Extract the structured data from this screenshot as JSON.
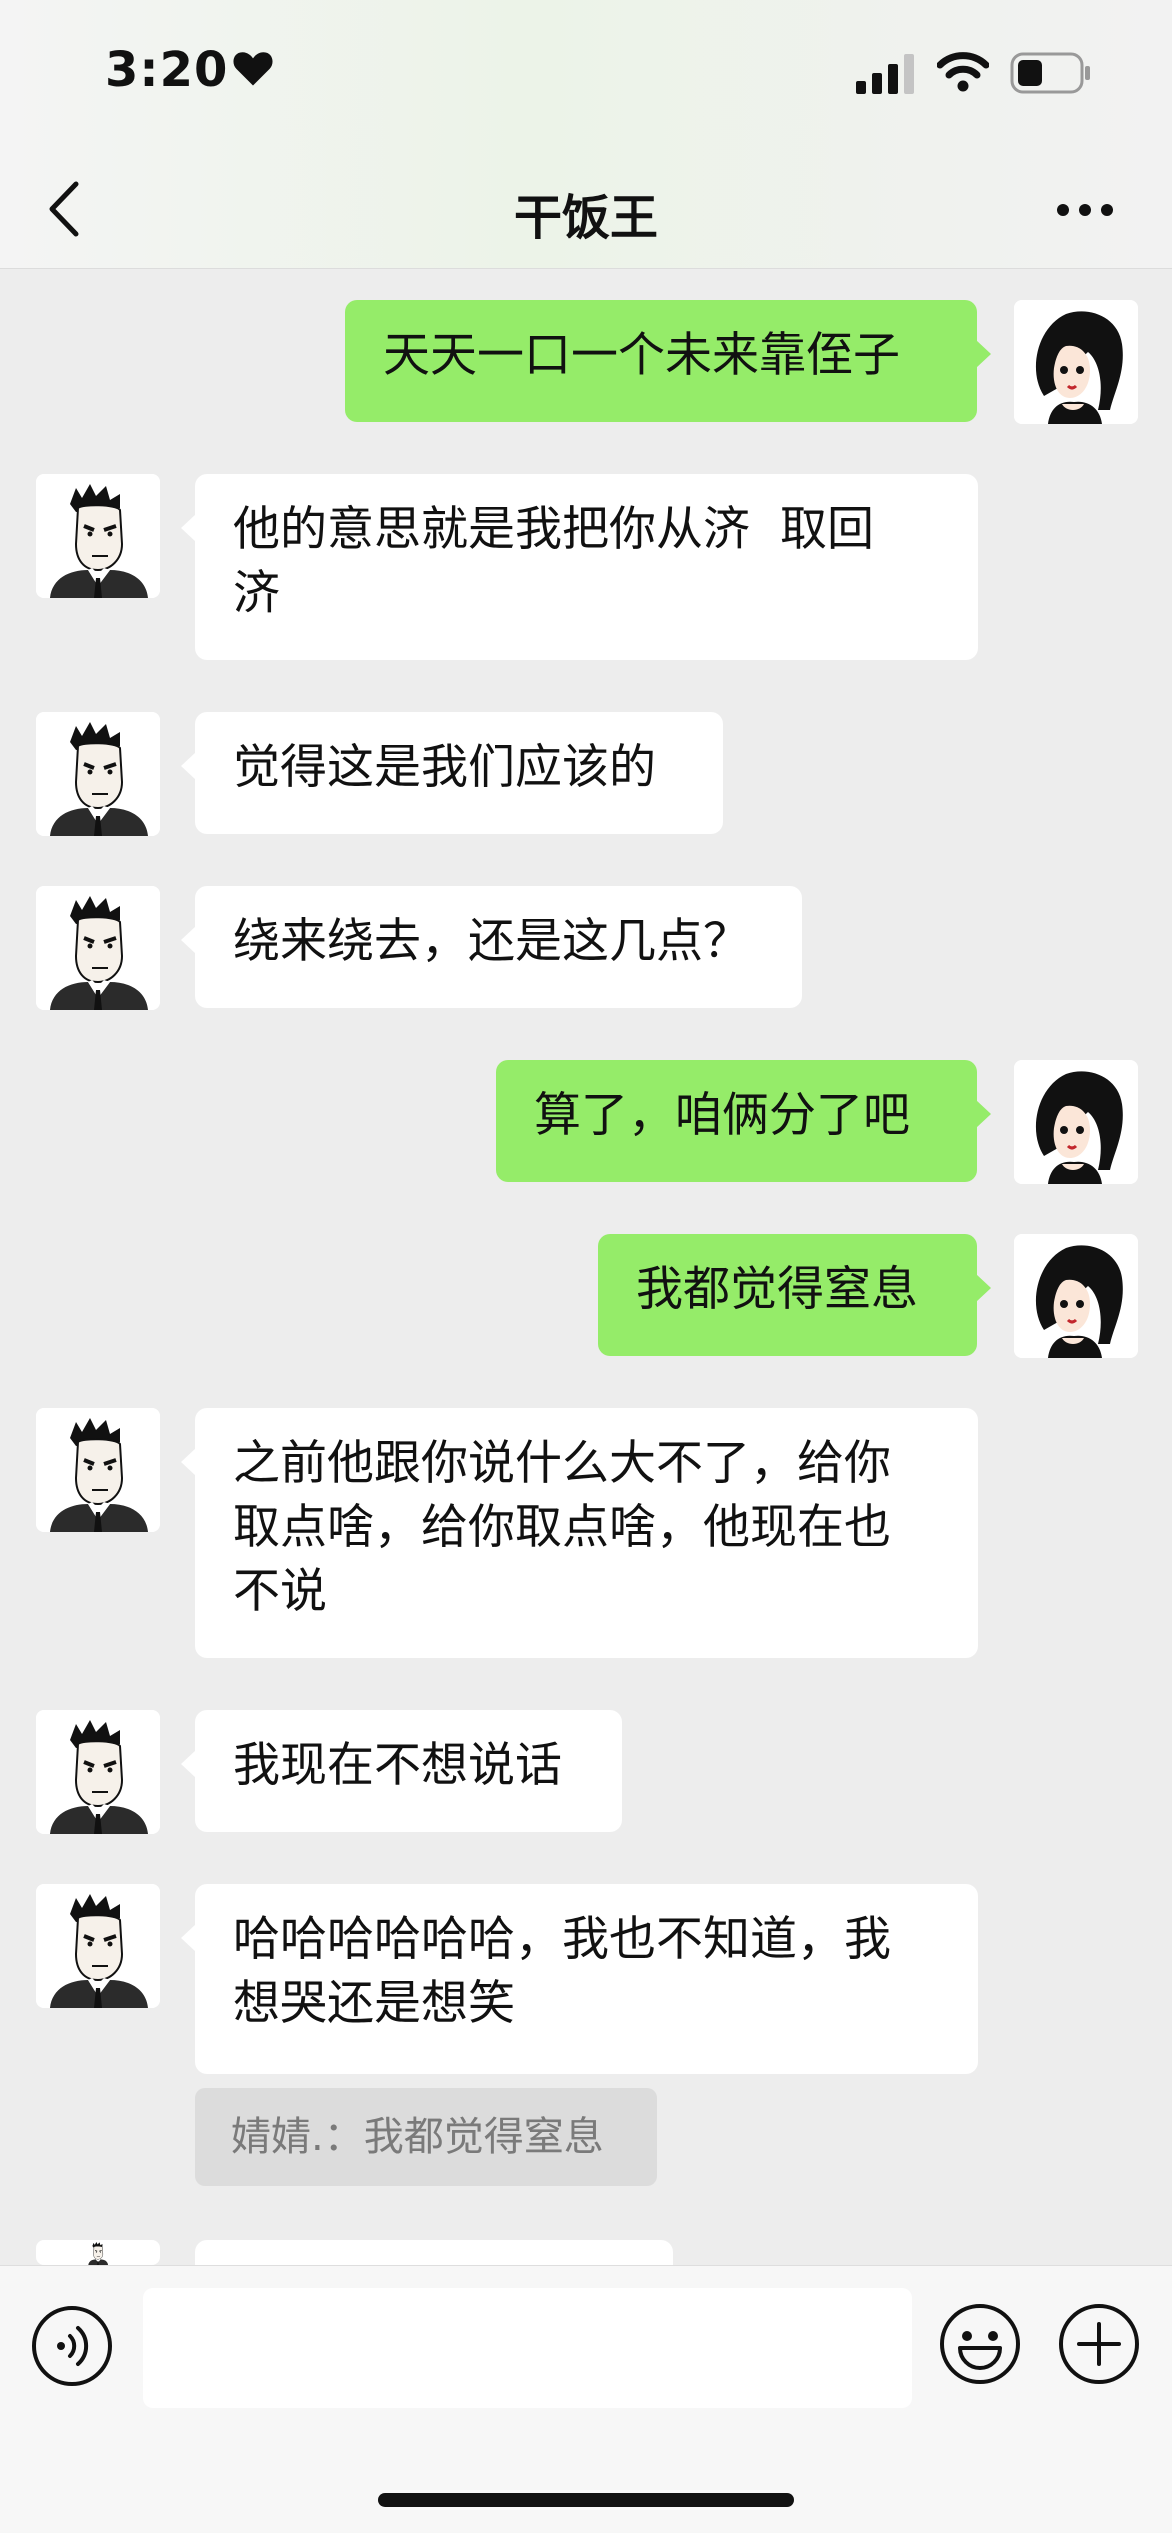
{
  "status_bar": {
    "time": "3:20"
  },
  "header": {
    "title": "干饭王"
  },
  "messages": [
    {
      "from": "me",
      "text": "天天一口一个未来靠侄子"
    },
    {
      "from": "other",
      "line1": "他的意思就是我把你从济",
      "line1b": "取回",
      "line2": "济"
    },
    {
      "from": "other",
      "text": "觉得这是我们应该的"
    },
    {
      "from": "other",
      "text": "绕来绕去，还是这几点？"
    },
    {
      "from": "me",
      "text": "算了，咱俩分了吧"
    },
    {
      "from": "me",
      "text": "我都觉得窒息"
    },
    {
      "from": "other",
      "line1": "之前他跟你说什么大不了，给你",
      "line2": "取点啥，给你取点啥，他现在也",
      "line3": "不说"
    },
    {
      "from": "other",
      "text": "我现在不想说话"
    },
    {
      "from": "other",
      "line1": "哈哈哈哈哈哈，我也不知道，我",
      "line2": "想哭还是想笑"
    }
  ],
  "quote": {
    "text": "婧婧.：我都觉得窒息"
  },
  "input": {
    "placeholder": ""
  },
  "colors": {
    "sent_bubble": "#95ec69",
    "received_bubble": "#ffffff",
    "background": "#ededed"
  }
}
